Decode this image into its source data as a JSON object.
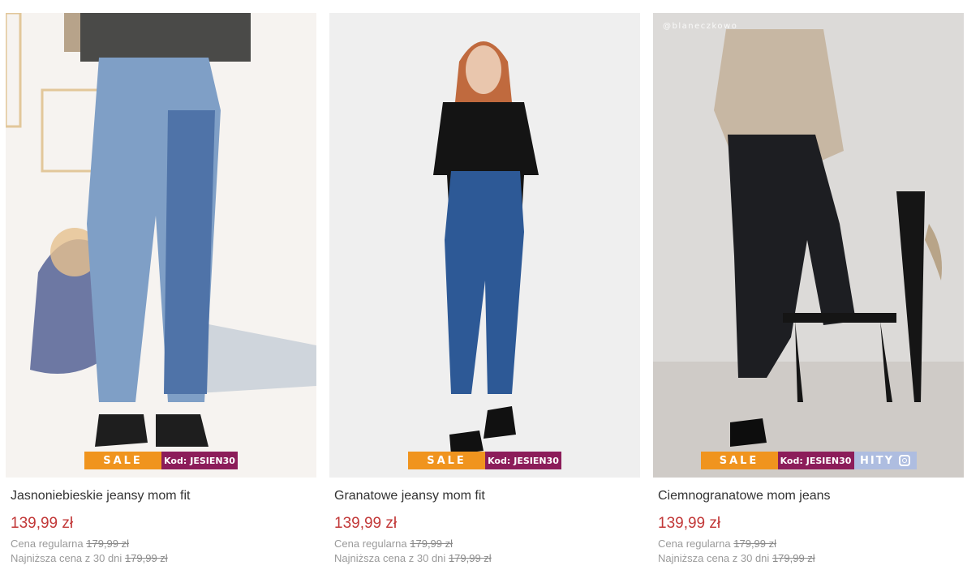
{
  "products": [
    {
      "name": "Jasnoniebieskie jeansy mom fit",
      "price": "139,99 zł",
      "regular_label": "Cena regularna",
      "regular_price": "179,99 zł",
      "lowest_label": "Najniższa cena z 30 dni",
      "lowest_price": "179,99 zł",
      "badge_sale": "SALE",
      "badge_code_label": "Kod:",
      "badge_code": "JESIEN30"
    },
    {
      "name": "Granatowe jeansy mom fit",
      "price": "139,99 zł",
      "regular_label": "Cena regularna",
      "regular_price": "179,99 zł",
      "lowest_label": "Najniższa cena z 30 dni",
      "lowest_price": "179,99 zł",
      "badge_sale": "SALE",
      "badge_code_label": "Kod:",
      "badge_code": "JESIEN30"
    },
    {
      "name": "Ciemnogranatowe mom jeans",
      "price": "139,99 zł",
      "regular_label": "Cena regularna",
      "regular_price": "179,99 zł",
      "lowest_label": "Najniższa cena z 30 dni",
      "lowest_price": "179,99 zł",
      "badge_sale": "SALE",
      "badge_code_label": "Kod:",
      "badge_code": "JESIEN30",
      "badge_hity": "HITY",
      "watermark": "@blaneczkowo"
    }
  ],
  "colors": {
    "price": "#c23838",
    "sale_badge": "#f0941e",
    "code_badge": "#8c1d5a",
    "hity_badge": "#aebde0"
  }
}
